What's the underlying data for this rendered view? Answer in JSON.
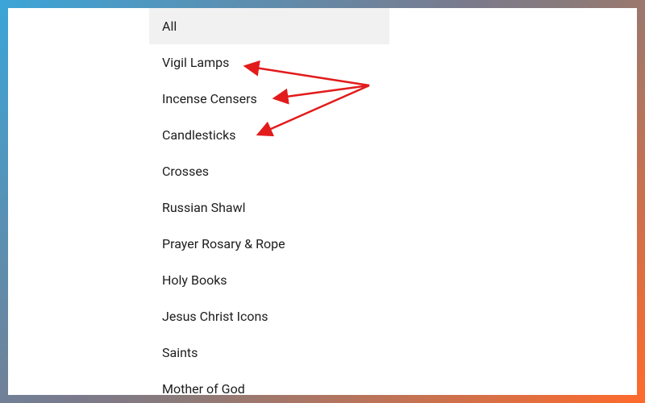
{
  "categoryList": {
    "items": [
      {
        "label": "All",
        "selected": true
      },
      {
        "label": "Vigil Lamps",
        "selected": false
      },
      {
        "label": "Incense Censers",
        "selected": false
      },
      {
        "label": "Candlesticks",
        "selected": false
      },
      {
        "label": "Crosses",
        "selected": false
      },
      {
        "label": "Russian Shawl",
        "selected": false
      },
      {
        "label": "Prayer Rosary & Rope",
        "selected": false
      },
      {
        "label": "Holy Books",
        "selected": false
      },
      {
        "label": "Jesus Christ Icons",
        "selected": false
      },
      {
        "label": "Saints",
        "selected": false
      },
      {
        "label": "Mother of God",
        "selected": false
      }
    ]
  },
  "annotation": {
    "arrowColor": "#e21b1b"
  }
}
